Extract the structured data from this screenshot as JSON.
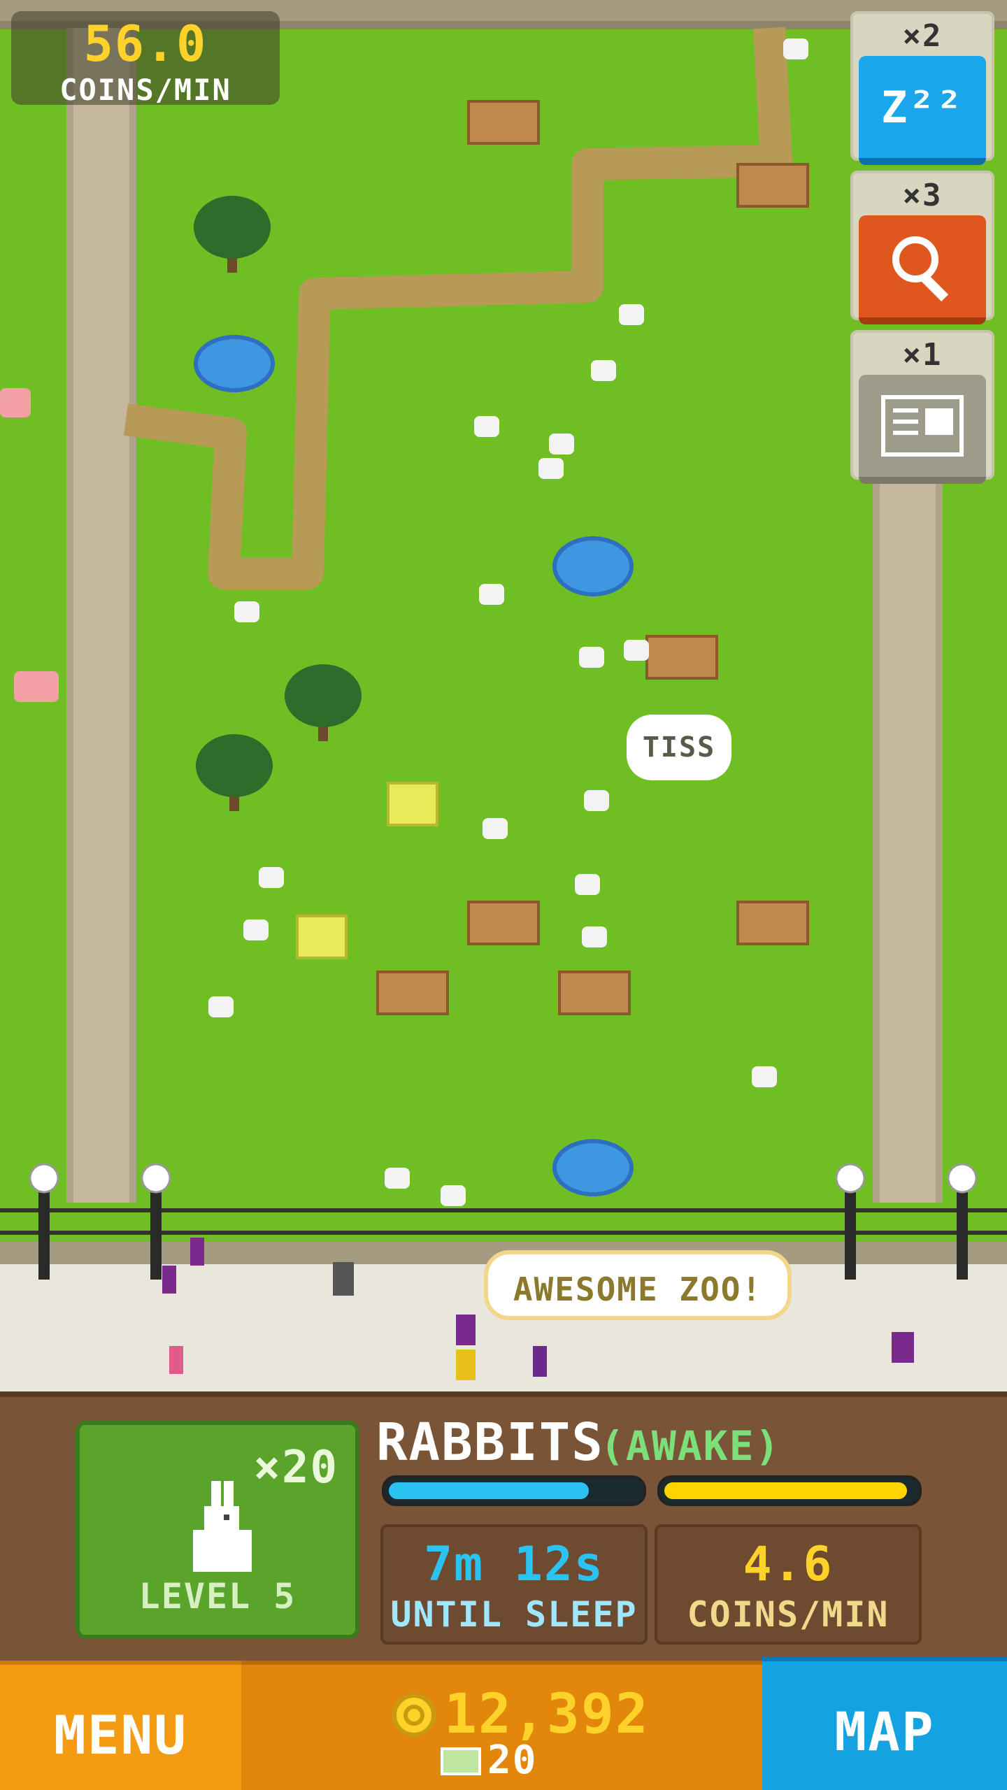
{
  "hud": {
    "coins_rate_value": "56.0",
    "coins_rate_label": "COINS/MIN"
  },
  "powerups": [
    {
      "count": "×2",
      "icon": "sleep-zzz-icon",
      "glyph": "Z²²"
    },
    {
      "count": "×3",
      "icon": "magnifier-icon"
    },
    {
      "count": "×1",
      "icon": "newspaper-icon"
    }
  ],
  "bubbles": {
    "animal": "TISS",
    "visitor": "AWESOME ZOO!"
  },
  "animal_panel": {
    "count": "×20",
    "level": "LEVEL 5",
    "name": "RABBITS",
    "state": "(AWAKE)",
    "sleep_bar_fraction": 0.8,
    "coin_bar_fraction": 0.97,
    "time_value": "7m 12s",
    "time_label": "UNTIL SLEEP",
    "rate_value": "4.6",
    "rate_label": "COINS/MIN"
  },
  "bottom": {
    "menu_label": "MENU",
    "coins": "12,392",
    "tickets": "20",
    "map_label": "MAP"
  },
  "colors": {
    "grass": "#6fbe24",
    "path": "#b69a55",
    "water": "#3e97e0",
    "accent_yellow": "#ffd22a",
    "sleep_bar": "#2bc4f2",
    "coin_bar": "#ffd400"
  }
}
